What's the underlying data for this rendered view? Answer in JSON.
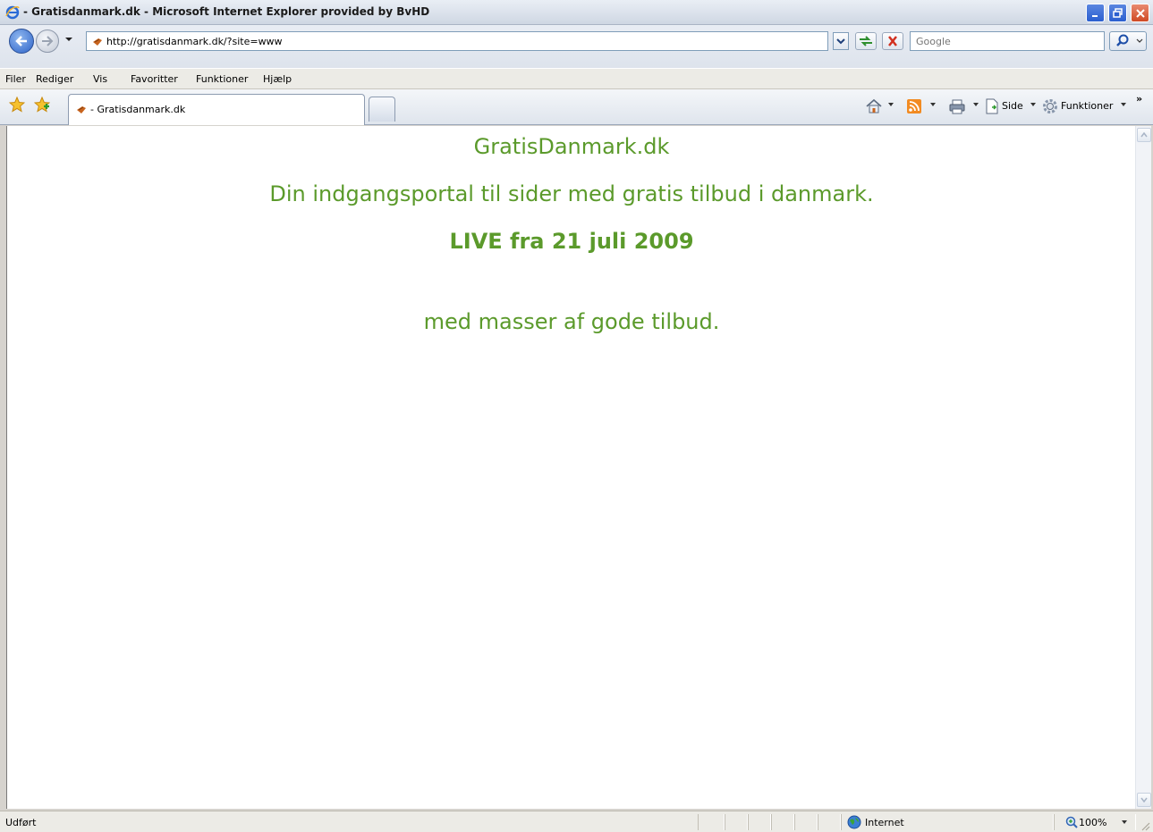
{
  "window": {
    "title": " - Gratisdanmark.dk - Microsoft Internet Explorer provided by BvHD"
  },
  "address_bar": {
    "url": "http://gratisdanmark.dk/?site=www",
    "search_placeholder": "Google"
  },
  "menu": {
    "items": [
      "Filer",
      "Rediger",
      "Vis",
      "Favoritter",
      "Funktioner",
      "Hjælp"
    ]
  },
  "tabs": [
    {
      "label": " - Gratisdanmark.dk"
    }
  ],
  "command_bar": {
    "page_label": "Side",
    "tools_label": "Funktioner",
    "more": "»"
  },
  "page": {
    "title": "GratisDanmark.dk",
    "tagline": "Din indgangsportal til sider med gratis tilbud i danmark.",
    "live": "LIVE fra 21 juli 2009",
    "offers": "med masser af gode tilbud."
  },
  "status_bar": {
    "status": "Udført",
    "zone": "Internet",
    "zoom": "100%"
  },
  "colors": {
    "content_green": "#5b9a2b"
  }
}
